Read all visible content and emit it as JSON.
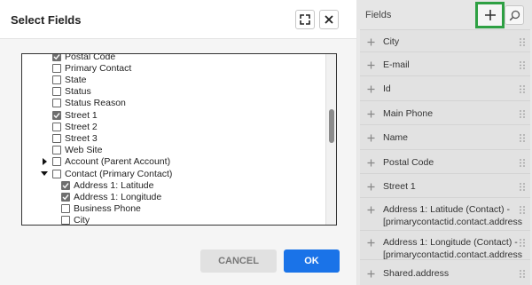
{
  "dialog": {
    "title": "Select Fields",
    "tree_items": [
      {
        "label": "Postal Code",
        "checked": true,
        "indent": 0,
        "caret": "none"
      },
      {
        "label": "Primary Contact",
        "checked": false,
        "indent": 0,
        "caret": "none"
      },
      {
        "label": "State",
        "checked": false,
        "indent": 0,
        "caret": "none"
      },
      {
        "label": "Status",
        "checked": false,
        "indent": 0,
        "caret": "none"
      },
      {
        "label": "Status Reason",
        "checked": false,
        "indent": 0,
        "caret": "none"
      },
      {
        "label": "Street 1",
        "checked": true,
        "indent": 0,
        "caret": "none"
      },
      {
        "label": "Street 2",
        "checked": false,
        "indent": 0,
        "caret": "none"
      },
      {
        "label": "Street 3",
        "checked": false,
        "indent": 0,
        "caret": "none"
      },
      {
        "label": "Web Site",
        "checked": false,
        "indent": 0,
        "caret": "none"
      },
      {
        "label": "Account (Parent Account)",
        "checked": false,
        "indent": 0,
        "caret": "right"
      },
      {
        "label": "Contact (Primary Contact)",
        "checked": false,
        "indent": 0,
        "caret": "down"
      },
      {
        "label": "Address 1: Latitude",
        "checked": true,
        "indent": 1,
        "caret": "none"
      },
      {
        "label": "Address 1: Longitude",
        "checked": true,
        "indent": 1,
        "caret": "none"
      },
      {
        "label": "Business Phone",
        "checked": false,
        "indent": 1,
        "caret": "none"
      },
      {
        "label": "City",
        "checked": false,
        "indent": 1,
        "caret": "none"
      }
    ],
    "cancel_label": "CANCEL",
    "ok_label": "OK"
  },
  "panel": {
    "title": "Fields",
    "fields": [
      {
        "label": "City"
      },
      {
        "label": "E-mail"
      },
      {
        "label": "Id"
      },
      {
        "label": "Main Phone"
      },
      {
        "label": "Name"
      },
      {
        "label": "Postal Code"
      },
      {
        "label": "Street 1"
      },
      {
        "label": "Address 1: Latitude (Contact) - [primarycontactid.contact.address"
      },
      {
        "label": "Address 1: Longitude (Contact) - [primarycontactid.contact.address"
      },
      {
        "label": "Shared.address"
      }
    ]
  },
  "icons": {
    "expand": "expand-icon",
    "close": "close-icon",
    "add": "plus-icon",
    "search": "search-icon",
    "drag": "drag-handle-icon",
    "check": "checkmark-icon",
    "caret_right": "caret-right-icon",
    "caret_down": "caret-down-icon"
  },
  "colors": {
    "ok_button": "#1a73e8",
    "add_highlight": "#2ea043",
    "checked_box": "#6f6f6f"
  }
}
